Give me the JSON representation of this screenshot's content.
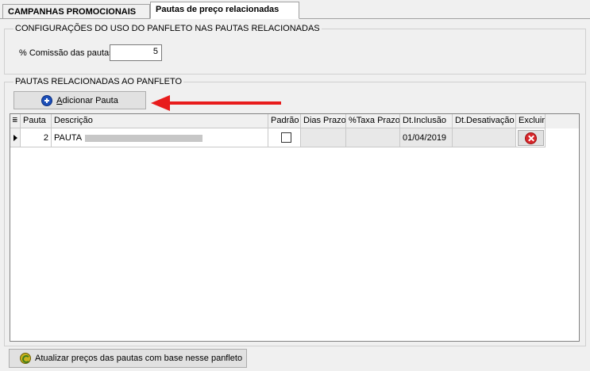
{
  "tabs": [
    {
      "label": "CAMPANHAS PROMOCIONAIS",
      "active": false
    },
    {
      "label": "Pautas de preço relacionadas",
      "active": true
    }
  ],
  "config_group": {
    "title": "CONFIGURAÇÕES DO USO DO PANFLETO NAS PAUTAS RELACIONADAS",
    "comissao_label": "% Comissão das pautas",
    "comissao_value": "5"
  },
  "pautas_group": {
    "title": "PAUTAS RELACIONADAS AO PANFLETO",
    "add_button": {
      "prefix": "",
      "underlined": "A",
      "rest": "dicionar Pauta",
      "icon": "plus-circle-icon"
    },
    "columns": [
      "Pauta",
      "Descrição",
      "Padrão",
      "Dias Prazo",
      "%Taxa Prazo",
      "Dt.Inclusão",
      "Dt.Desativação",
      "Excluir"
    ],
    "rows": [
      {
        "pauta": "2",
        "descricao": "PAUTA",
        "padrao": false,
        "dias_prazo": "",
        "taxa_prazo": "",
        "dt_inclusao": "01/04/2019",
        "dt_desativacao": ""
      }
    ]
  },
  "update_button": {
    "label": "Atualizar preços das pautas com base nesse panfleto",
    "icon": "refresh-icon"
  },
  "colors": {
    "arrow": "#e81c1c",
    "delete": "#d8262b",
    "plus": "#1c4fb8"
  }
}
